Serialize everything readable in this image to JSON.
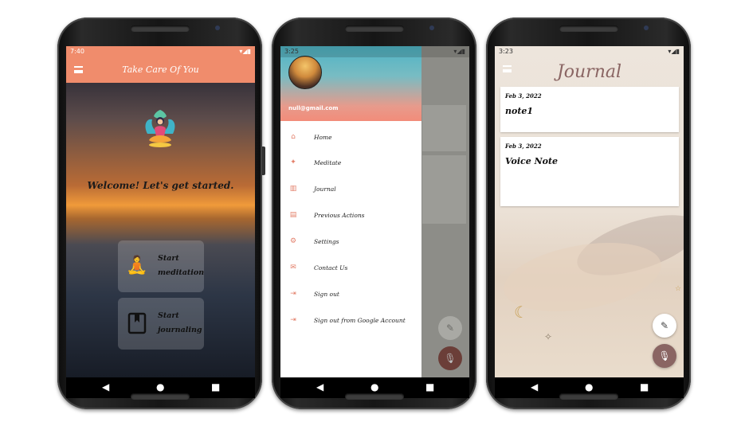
{
  "phone1": {
    "status_time": "7:40",
    "status_right": "▾◢▮",
    "appbar_title": "Take Care Of You",
    "welcome": "Welcome! Let's get started.",
    "card_meditation": "Start meditation",
    "card_journaling": "Start journaling",
    "accent": "#f08c6c"
  },
  "phone2": {
    "status_time": "3:25",
    "status_right": "▾◢▮",
    "email": "null@gmail.com",
    "menu": [
      {
        "label": "Home",
        "icon": "home-icon"
      },
      {
        "label": "Meditate",
        "icon": "sparkle-icon"
      },
      {
        "label": "Journal",
        "icon": "book-icon"
      },
      {
        "label": "Previous Actions",
        "icon": "clipboard-icon"
      },
      {
        "label": "Settings",
        "icon": "gear-icon"
      },
      {
        "label": "Contact Us",
        "icon": "mail-icon"
      },
      {
        "label": "Sign out",
        "icon": "logout-icon"
      },
      {
        "label": "Sign out from Google Account",
        "icon": "logout-icon"
      }
    ]
  },
  "phone3": {
    "status_time": "3:23",
    "status_right": "▾◢▮",
    "title": "Journal",
    "notes": [
      {
        "date": "Feb 3, 2022",
        "title": "note1"
      },
      {
        "date": "Feb 3, 2022",
        "title": "Voice Note"
      }
    ]
  },
  "nav": {
    "back": "◀",
    "home": "●",
    "recents": "■"
  }
}
